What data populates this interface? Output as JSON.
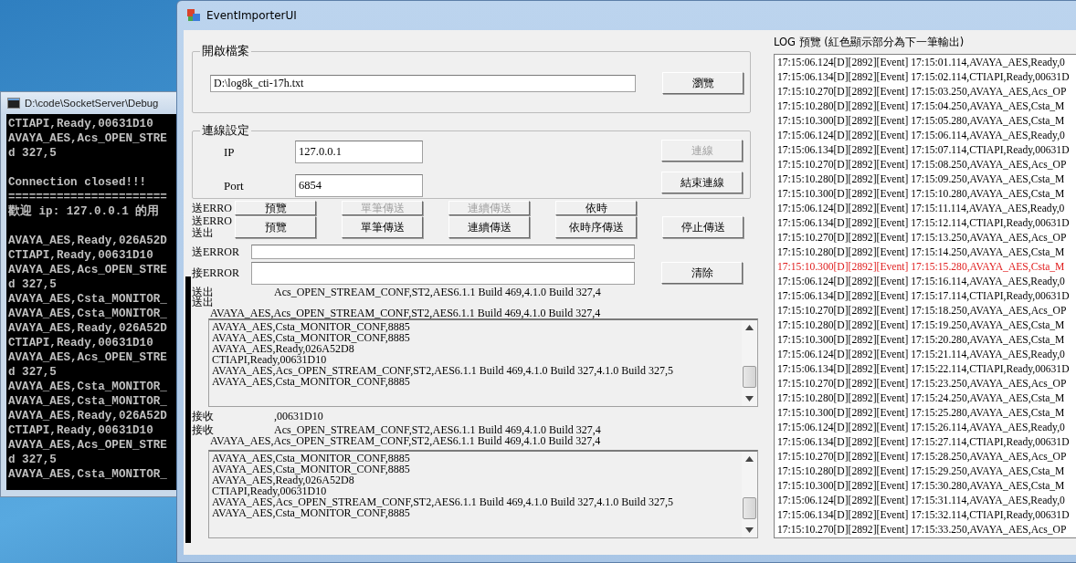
{
  "console_window": {
    "title": "D:\\code\\SocketServer\\Debug",
    "lines": [
      [
        "CTIAPI,Ready,00631D10",
        "AVAYA_AES,Acs_OPEN_STRE",
        "d 327,5"
      ],
      [
        "Connection closed!!!",
        "=======================",
        "歡迎 ip: 127.0.0.1 的用"
      ],
      [
        "AVAYA_AES,Ready,026A52D",
        "CTIAPI,Ready,00631D10",
        "AVAYA_AES,Acs_OPEN_STRE",
        "d 327,5",
        "AVAYA_AES,Csta_MONITOR_",
        "AVAYA_AES,Csta_MONITOR_",
        "AVAYA_AES,Ready,026A52D",
        "CTIAPI,Ready,00631D10",
        "AVAYA_AES,Acs_OPEN_STRE",
        "d 327,5",
        "AVAYA_AES,Csta_MONITOR_",
        "AVAYA_AES,Csta_MONITOR_",
        "AVAYA_AES,Ready,026A52D",
        "CTIAPI,Ready,00631D10",
        "AVAYA_AES,Acs_OPEN_STRE",
        "d 327,5",
        "AVAYA_AES,Csta_MONITOR_"
      ]
    ]
  },
  "main_window": {
    "title": "EventImporterUI",
    "file_group": {
      "label": "開啟檔案",
      "path": "D:\\log8k_cti-17h.txt",
      "browse_button": "瀏覽"
    },
    "connection_group": {
      "label": "連線設定",
      "ip_label": "IP",
      "ip": "127.0.0.1",
      "port_label": "Port",
      "port": "6854",
      "buttons": [
        {
          "label": "連線",
          "disabled": true
        },
        {
          "label": "結束連線",
          "disabled": false
        }
      ]
    },
    "ghost_row": {
      "label": "送ERRO",
      "buttons": [
        {
          "label": "預覽",
          "disabled": false
        },
        {
          "label": "單筆傳送",
          "disabled": true
        },
        {
          "label": "連續傳送",
          "disabled": true
        },
        {
          "label": "依時",
          "disabled": false
        }
      ]
    },
    "send_row": {
      "labels": [
        "送ERRO",
        "送出"
      ],
      "buttons": [
        {
          "label": "預覽",
          "disabled": false
        },
        {
          "label": "單筆傳送",
          "disabled": false
        },
        {
          "label": "連續傳送",
          "disabled": false
        },
        {
          "label": "依時序傳送",
          "disabled": false
        },
        {
          "label": "停止傳送",
          "disabled": false
        }
      ]
    },
    "status_rows": [
      {
        "label": "送ERROR"
      },
      {
        "label": "接ERROR"
      }
    ],
    "clear_button": "清除",
    "send_echo": [
      {
        "label": "送出",
        "text": "Acs_OPEN_STREAM_CONF,ST2,AES6.1.1 Build 469,4.1.0 Build 327,4"
      },
      {
        "label": "送出",
        "text": "AVAYA_AES,Acs_OPEN_STREAM_CONF,ST2,AES6.1.1 Build 469,4.1.0 Build 327,4"
      }
    ],
    "send_list": {
      "lines": [
        "AVAYA_AES,Csta_MONITOR_CONF,8885",
        "AVAYA_AES,Csta_MONITOR_CONF,8885",
        "AVAYA_AES,Ready,026A52D8",
        "CTIAPI,Ready,00631D10",
        "AVAYA_AES,Acs_OPEN_STREAM_CONF,ST2,AES6.1.1 Build 469,4.1.0 Build 327,4.1.0 Build 327,5",
        "AVAYA_AES,Csta_MONITOR_CONF,8885"
      ]
    },
    "receive_echo": [
      {
        "label": "接收",
        "text": ",00631D10"
      },
      {
        "label": "接收",
        "text": "Acs_OPEN_STREAM_CONF,ST2,AES6.1.1 Build 469,4.1.0 Build 327,4"
      },
      {
        "text": "AVAYA_AES,Acs_OPEN_STREAM_CONF,ST2,AES6.1.1 Build 469,4.1.0 Build 327,4"
      }
    ],
    "receive_list": {
      "lines": [
        "AVAYA_AES,Csta_MONITOR_CONF,8885",
        "AVAYA_AES,Csta_MONITOR_CONF,8885",
        "AVAYA_AES,Ready,026A52D8",
        "CTIAPI,Ready,00631D10",
        "AVAYA_AES,Acs_OPEN_STREAM_CONF,ST2,AES6.1.1 Build 469,4.1.0 Build 327,4.1.0 Build 327,5",
        "AVAYA_AES,Csta_MONITOR_CONF,8885"
      ]
    },
    "log_preview": {
      "title": "LOG 預覽 (紅色顯示部分為下一筆輸出)",
      "lines": [
        {
          "text": "17:15:06.124[D][2892][Event] 17:15:01.114,AVAYA_AES,Ready,0",
          "next": false
        },
        {
          "text": "17:15:06.134[D][2892][Event] 17:15:02.114,CTIAPI,Ready,00631D",
          "next": false
        },
        {
          "text": "17:15:10.270[D][2892][Event] 17:15:03.250,AVAYA_AES,Acs_OP",
          "next": false
        },
        {
          "text": "17:15:10.280[D][2892][Event] 17:15:04.250,AVAYA_AES,Csta_M",
          "next": false
        },
        {
          "text": "17:15:10.300[D][2892][Event] 17:15:05.280,AVAYA_AES,Csta_M",
          "next": false
        },
        {
          "text": "17:15:06.124[D][2892][Event] 17:15:06.114,AVAYA_AES,Ready,0",
          "next": false
        },
        {
          "text": "17:15:06.134[D][2892][Event] 17:15:07.114,CTIAPI,Ready,00631D",
          "next": false
        },
        {
          "text": "17:15:10.270[D][2892][Event] 17:15:08.250,AVAYA_AES,Acs_OP",
          "next": false
        },
        {
          "text": "17:15:10.280[D][2892][Event] 17:15:09.250,AVAYA_AES,Csta_M",
          "next": false
        },
        {
          "text": "17:15:10.300[D][2892][Event] 17:15:10.280,AVAYA_AES,Csta_M",
          "next": false
        },
        {
          "text": "17:15:06.124[D][2892][Event] 17:15:11.114,AVAYA_AES,Ready,0",
          "next": false
        },
        {
          "text": "17:15:06.134[D][2892][Event] 17:15:12.114,CTIAPI,Ready,00631D",
          "next": false
        },
        {
          "text": "17:15:10.270[D][2892][Event] 17:15:13.250,AVAYA_AES,Acs_OP",
          "next": false
        },
        {
          "text": "17:15:10.280[D][2892][Event] 17:15:14.250,AVAYA_AES,Csta_M",
          "next": false
        },
        {
          "text": "17:15:10.300[D][2892][Event] 17:15:15.280,AVAYA_AES,Csta_M",
          "next": true
        },
        {
          "text": "17:15:06.124[D][2892][Event] 17:15:16.114,AVAYA_AES,Ready,0",
          "next": false
        },
        {
          "text": "17:15:06.134[D][2892][Event] 17:15:17.114,CTIAPI,Ready,00631D",
          "next": false
        },
        {
          "text": "17:15:10.270[D][2892][Event] 17:15:18.250,AVAYA_AES,Acs_OP",
          "next": false
        },
        {
          "text": "17:15:10.280[D][2892][Event] 17:15:19.250,AVAYA_AES,Csta_M",
          "next": false
        },
        {
          "text": "17:15:10.300[D][2892][Event] 17:15:20.280,AVAYA_AES,Csta_M",
          "next": false
        },
        {
          "text": "17:15:06.124[D][2892][Event] 17:15:21.114,AVAYA_AES,Ready,0",
          "next": false
        },
        {
          "text": "17:15:06.134[D][2892][Event] 17:15:22.114,CTIAPI,Ready,00631D",
          "next": false
        },
        {
          "text": "17:15:10.270[D][2892][Event] 17:15:23.250,AVAYA_AES,Acs_OP",
          "next": false
        },
        {
          "text": "17:15:10.280[D][2892][Event] 17:15:24.250,AVAYA_AES,Csta_M",
          "next": false
        },
        {
          "text": "17:15:10.300[D][2892][Event] 17:15:25.280,AVAYA_AES,Csta_M",
          "next": false
        },
        {
          "text": "17:15:06.124[D][2892][Event] 17:15:26.114,AVAYA_AES,Ready,0",
          "next": false
        },
        {
          "text": "17:15:06.134[D][2892][Event] 17:15:27.114,CTIAPI,Ready,00631D",
          "next": false
        },
        {
          "text": "17:15:10.270[D][2892][Event] 17:15:28.250,AVAYA_AES,Acs_OP",
          "next": false
        },
        {
          "text": "17:15:10.280[D][2892][Event] 17:15:29.250,AVAYA_AES,Csta_M",
          "next": false
        },
        {
          "text": "17:15:10.300[D][2892][Event] 17:15:30.280,AVAYA_AES,Csta_M",
          "next": false
        },
        {
          "text": "17:15:06.124[D][2892][Event] 17:15:31.114,AVAYA_AES,Ready,0",
          "next": false
        },
        {
          "text": "17:15:06.134[D][2892][Event] 17:15:32.114,CTIAPI,Ready,00631D",
          "next": false
        },
        {
          "text": "17:15:10.270[D][2892][Event] 17:15:33.250,AVAYA_AES,Acs_OP",
          "next": false
        }
      ]
    }
  }
}
